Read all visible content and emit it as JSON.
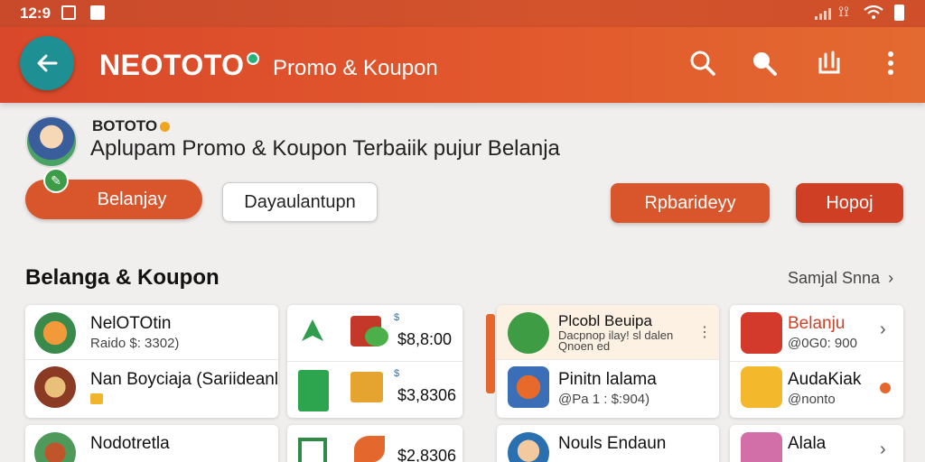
{
  "status_bar": {
    "time": "1⁠2:9"
  },
  "app_bar": {
    "brand": "NEOTOTO",
    "subtitle": "Promo & Koupon"
  },
  "hero": {
    "brand": "BOTOTO",
    "tagline": "Aplupam Promo & Koupon Terbaiik pujur Belanja",
    "buttons": [
      "Belanjay",
      "Dayaulantupn",
      "Rpbarideyy",
      "Hopoj"
    ]
  },
  "section": {
    "title": "Belanga & Koupon",
    "see_all": "Samjal Snna"
  },
  "card1": [
    {
      "title": "NelOTOtin",
      "sub": "Raido $: 3302)"
    },
    {
      "title": "Nan Boyciaja (Sariideanl",
      "sub": ""
    },
    {
      "title": "Nodotretla",
      "sub": ""
    }
  ],
  "card2": [
    {
      "price": "$8,8:00",
      "mini": "$"
    },
    {
      "price": "$3,8306",
      "mini": "$"
    },
    {
      "price": "$2,8306",
      "mini": ""
    }
  ],
  "card3": [
    {
      "title": "Plcobl Beuipa",
      "sub": "Dacpnop ilay! sl dalen\nQnoen ed"
    },
    {
      "title": "Pinitn lalama",
      "sub": "@Pa 1 : $:904)"
    },
    {
      "title": "Nouls Endaun",
      "sub": ""
    }
  ],
  "card4": [
    {
      "title": "Belanju",
      "sub": "@0G0: 900"
    },
    {
      "title": "AudaKiak",
      "sub": "@nonto"
    },
    {
      "title": "Alala",
      "sub": ""
    }
  ],
  "colors": {
    "primary": "#d9552b",
    "teal": "#1e8f93",
    "accent": "#e4682d"
  }
}
